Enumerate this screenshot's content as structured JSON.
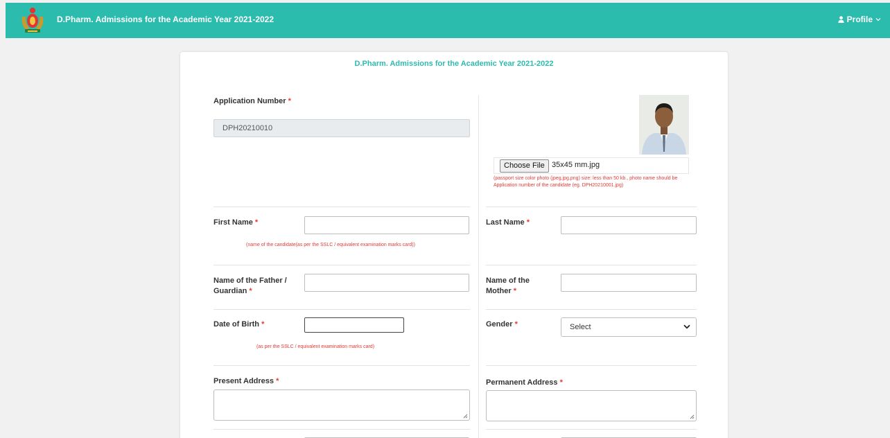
{
  "navbar": {
    "title": "D.Pharm. Admissions for the Academic Year 2021-2022",
    "logo_icon": "state-emblem-logo",
    "profile_label": "Profile",
    "profile_icon": "user-icon",
    "caret_icon": "caret-down-icon",
    "color": "#2bbcae"
  },
  "form": {
    "title": "D.Pharm. Admissions for the Academic Year 2021-2022",
    "required_mark": "*",
    "application_number": {
      "label": "Application Number",
      "value": "DPH20210010"
    },
    "photo": {
      "button_label": "Choose File",
      "file_name": "35x45 mm.jpg",
      "note": "(passport size color photo (jpeg,jpg,png) size: less than 50 kb., photo name should be Application number of the candidate (eg. DPH20210001.jpg)"
    },
    "first_name": {
      "label": "First Name",
      "value": "",
      "note": "(name of the candidate(as per the SSLC / equivalent examination marks card))"
    },
    "last_name": {
      "label": "Last Name",
      "value": ""
    },
    "father_name": {
      "label": "Name of the Father / Guardian",
      "value": ""
    },
    "mother_name": {
      "label": "Name of the Mother",
      "value": ""
    },
    "dob": {
      "label": "Date of Birth",
      "value": "",
      "note": "(as per the SSLC / equivalent examination marks card)"
    },
    "gender": {
      "label": "Gender",
      "selected": "Select"
    },
    "present_address": {
      "label": "Present Address",
      "value": ""
    },
    "permanent_address": {
      "label": "Permanent Address",
      "value": ""
    }
  },
  "colors": {
    "accent": "#2bbcae",
    "required": "#e53935",
    "page_bg": "#f1f1f1"
  }
}
